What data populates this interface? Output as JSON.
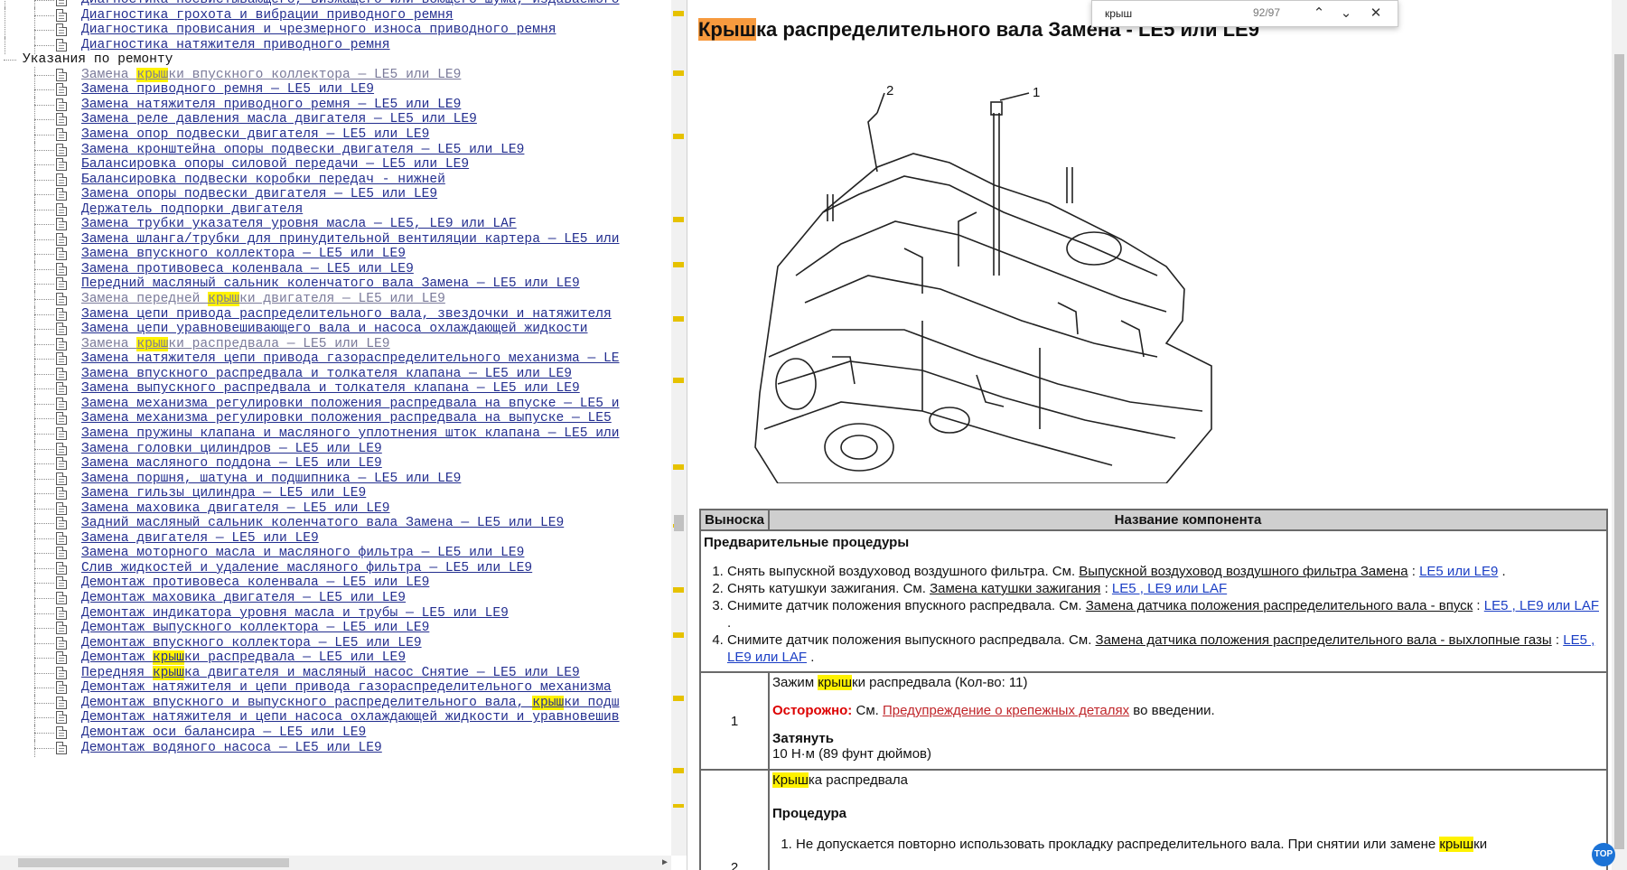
{
  "tree": {
    "items": [
      {
        "label": "Диагностика посвистывающего, визжащего или воющего шума, издаваемого",
        "kind": "link"
      },
      {
        "label": "Диагностика грохота и вибрации приводного ремня",
        "kind": "link"
      },
      {
        "label": "Диагностика провисания и чрезмерного износа приводного ремня",
        "kind": "link"
      },
      {
        "label": "Диагностика натяжителя приводного ремня",
        "kind": "link"
      },
      {
        "label": "Указания по ремонту",
        "kind": "folder"
      },
      {
        "pre": "Замена ",
        "hl": "крыш",
        "post": "ки впускного коллектора — LE5 или LE9",
        "kind": "link",
        "visited": true
      },
      {
        "label": "Замена приводного ремня — LE5 или LE9",
        "kind": "link"
      },
      {
        "label": "Замена натяжителя приводного ремня — LE5 или LE9",
        "kind": "link"
      },
      {
        "label": "Замена реле давления масла двигателя — LE5 или LE9",
        "kind": "link"
      },
      {
        "label": "Замена опор подвески двигателя — LE5 или LE9",
        "kind": "link"
      },
      {
        "label": "Замена кронштейна опоры подвески двигателя — LE5 или LE9",
        "kind": "link"
      },
      {
        "label": "Балансировка опоры силовой передачи — LE5 или LE9",
        "kind": "link"
      },
      {
        "label": "Балансировка подвески коробки передач - нижней",
        "kind": "link"
      },
      {
        "label": "Замена опоры подвески двигателя — LE5 или LE9",
        "kind": "link"
      },
      {
        "label": "Держатель подпорки двигателя",
        "kind": "link"
      },
      {
        "label": "Замена трубки указателя уровня масла — LE5, LE9 или LAF",
        "kind": "link"
      },
      {
        "label": "Замена шланга/трубки для принудительной вентиляции картера — LE5 или",
        "kind": "link"
      },
      {
        "label": "Замена впускного коллектора — LE5 или LE9",
        "kind": "link"
      },
      {
        "label": "Замена противовеса коленвала — LE5 или LE9",
        "kind": "link"
      },
      {
        "label": "Передний масляный сальник коленчатого вала Замена — LE5 или LE9",
        "kind": "link"
      },
      {
        "pre": "Замена передней ",
        "hl": "крыш",
        "post": "ки двигателя — LE5 или LE9",
        "kind": "link",
        "visited": true
      },
      {
        "label": "Замена цепи привода распределительного вала, звездочки и натяжителя",
        "kind": "link"
      },
      {
        "label": "Замена цепи уравновешивающего вала и насоса охлаждающей жидкости",
        "kind": "link"
      },
      {
        "pre": "Замена ",
        "hl": "крыш",
        "post": "ки распредвала — LE5 или LE9",
        "kind": "link",
        "visited": true
      },
      {
        "label": "Замена натяжителя цепи привода газораспределительного механизма — LE",
        "kind": "link"
      },
      {
        "label": "Замена впускного распредвала и толкателя клапана — LE5 или LE9",
        "kind": "link"
      },
      {
        "label": "Замена выпускного распредвала и толкателя клапана — LE5 или LE9",
        "kind": "link"
      },
      {
        "label": "Замена механизма регулировки положения распредвала на впуске — LE5 и",
        "kind": "link"
      },
      {
        "label": "Замена механизма регулировки положения распредвала на выпуске — LE5",
        "kind": "link"
      },
      {
        "label": "Замена пружины клапана и масляного уплотнения шток клапана — LE5 или",
        "kind": "link"
      },
      {
        "label": "Замена головки цилиндров — LE5 или LE9",
        "kind": "link"
      },
      {
        "label": "Замена масляного поддона — LE5 или LE9",
        "kind": "link"
      },
      {
        "label": "Замена поршня, шатуна и подшипника — LE5 или LE9",
        "kind": "link"
      },
      {
        "label": "Замена гильзы цилиндра — LE5 или LE9",
        "kind": "link"
      },
      {
        "label": "Замена маховика двигателя — LE5 или LE9",
        "kind": "link"
      },
      {
        "label": "Задний масляный сальник коленчатого вала Замена — LE5 или LE9",
        "kind": "link"
      },
      {
        "label": "Замена двигателя — LE5 или LE9",
        "kind": "link"
      },
      {
        "label": "Замена моторного масла и масляного фильтра — LE5 или LE9",
        "kind": "link"
      },
      {
        "label": "Слив жидкостей и удаление масляного фильтра — LE5 или LE9",
        "kind": "link"
      },
      {
        "label": "Демонтаж противовеса коленвала — LE5 или LE9",
        "kind": "link"
      },
      {
        "label": "Демонтаж маховика двигателя — LE5 или LE9",
        "kind": "link"
      },
      {
        "label": "Демонтаж индикатора уровня масла и трубы — LE5 или LE9",
        "kind": "link"
      },
      {
        "label": "Демонтаж выпускного коллектора — LE5 или LE9",
        "kind": "link"
      },
      {
        "label": "Демонтаж впускного коллектора — LE5 или LE9",
        "kind": "link"
      },
      {
        "pre": "Демонтаж ",
        "hl": "крыш",
        "post": "ки распредвала — LE5 или LE9",
        "kind": "link"
      },
      {
        "pre": "Передняя ",
        "hl": "крыш",
        "post": "ка двигателя и масляный насос Снятие — LE5 или LE9",
        "kind": "link"
      },
      {
        "label": "Демонтаж натяжителя и цепи привода газораспределительного механизма",
        "kind": "link"
      },
      {
        "pre": "Демонтаж впускного и выпускного распределительного вала, ",
        "hl": "крыш",
        "post": "ки подш",
        "kind": "link"
      },
      {
        "label": "Демонтаж натяжителя и цепи насоса охлаждающей жидкости и уравновешив",
        "kind": "link"
      },
      {
        "label": "Демонтаж оси балансира — LE5 или LE9",
        "kind": "link"
      },
      {
        "label": "Демонтаж водяного насоса — LE5 или LE9",
        "kind": "link"
      }
    ]
  },
  "find": {
    "query": "крыш",
    "count": "92/97",
    "prev_icon": "chevron-up-icon",
    "next_icon": "chevron-down-icon",
    "close_icon": "close-icon"
  },
  "doc": {
    "title_hl": "Крыш",
    "title_rest": "ка распределительного вала Замена - LE5 или LE9",
    "figure_callouts": [
      "2",
      "1"
    ],
    "table": {
      "col_callout": "Выноска",
      "col_name": "Название компонента",
      "pre_title": "Предварительные процедуры",
      "steps": [
        {
          "text": "Снять выпускной воздуховод воздушного фильтра. См. ",
          "ref": "Выпускной воздуховод воздушного фильтра Замена",
          "sep": " : ",
          "variants": "LE5 или LE9",
          "end": " ."
        },
        {
          "text": "Снять катушкуи зажигания. См. ",
          "ref": "Замена катушки зажигания",
          "sep": " : ",
          "variants": "LE5 , LE9 или LAF",
          "end": ""
        },
        {
          "text": "Снимите датчик положения впускного распредвала. См. ",
          "ref": "Замена датчика положения распределительного вала - впуск",
          "sep": " : ",
          "variants": "LE5 , LE9 или LAF",
          "end": " ."
        },
        {
          "text": "Снимите датчик положения выпускного распредвала. См. ",
          "ref": "Замена датчика положения распределительного вала - выхлопные газы",
          "sep": " : ",
          "variants": "LE5 , LE9 или LAF",
          "end": " ."
        }
      ],
      "row1": {
        "callout": "1",
        "name_pre": "Зажим ",
        "name_hl": "крыш",
        "name_post": "ки распредвала (Кол-во: 11)",
        "caution_label": "Осторожно:",
        "caution_text": " См. ",
        "caution_link": "Предупреждение о крепежных деталях",
        "caution_end": " во введении.",
        "tighten_label": "Затянуть",
        "torque": "10 Н·м (89 фунт дюймов)"
      },
      "row2": {
        "callout": "2",
        "name_hl": "Крыш",
        "name_post": "ка распредвала",
        "procedure_label": "Процедура",
        "step1_pre": "Не допускается повторно использовать прокладку распределительного вала. При снятии или замене ",
        "step1_hl": "крыш",
        "step1_post": "ки"
      }
    }
  },
  "scroll_top_label": "TOP",
  "colors": {
    "link": "#232e8f",
    "highlight": "#fff200",
    "current_match": "#f79a3e",
    "blue_link": "#1a3ec5",
    "caution": "#dd0000"
  }
}
